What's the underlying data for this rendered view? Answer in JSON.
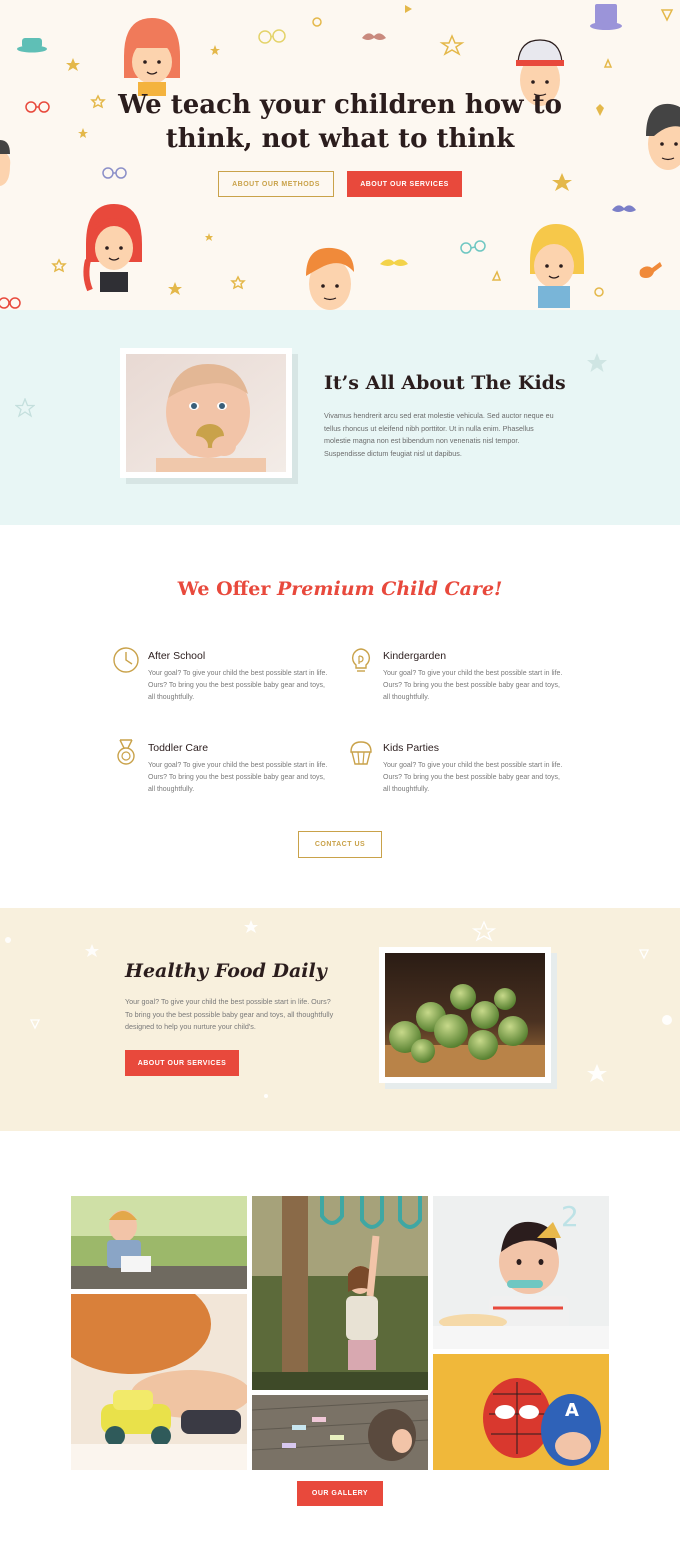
{
  "hero": {
    "title_pre": "We teach your children ",
    "title_bold1": "how to",
    "title_bold2": "think",
    "title_post": ", not what to think",
    "btn_methods": "About our methods",
    "btn_services": "About our services"
  },
  "kids": {
    "title_light": "It’s All About ",
    "title_bold": "The Kids",
    "text": "Vivamus hendrerit arcu sed erat molestie vehicula. Sed auctor neque eu tellus rhoncus ut eleifend nibh porttitor. Ut in nulla enim. Phasellus molestie magna non est bibendum non venenatis nisl tempor. Suspendisse dictum feugiat nisl ut dapibus."
  },
  "offer": {
    "title_bold": "We Offer",
    "title_italic": " Premium Child Care!",
    "services": [
      {
        "title": "After School",
        "icon": "clock-icon",
        "text": "Your goal? To give your child the best possible start in life. Ours? To bring you the best possible baby gear and toys, all thoughtfully."
      },
      {
        "title": "Kindergarden",
        "icon": "lightbulb-icon",
        "text": "Your goal? To give your child the best possible start in life. Ours? To bring you the best possible baby gear and toys, all thoughtfully."
      },
      {
        "title": "Toddler Care",
        "icon": "medal-icon",
        "text": "Your goal? To give your child the best possible start in life. Ours? To bring you the best possible baby gear and toys, all thoughtfully."
      },
      {
        "title": "Kids Parties",
        "icon": "cupcake-icon",
        "text": "Your goal? To give your child the best possible start in life. Ours? To bring you the best possible baby gear and toys, all thoughtfully."
      }
    ],
    "contact_btn": "Contact us"
  },
  "food": {
    "title_bold": "Healthy Food",
    "title_italic": " Daily",
    "text": "Your goal? To give your child the best possible start in life. Ours? To bring you the best possible baby gear and toys, all thoughtfully designed to help you nurture your child's.",
    "btn": "About our services"
  },
  "gallery": {
    "btn": "Our gallery"
  },
  "colors": {
    "accent_red": "#e8493c",
    "accent_gold": "#c9a24a",
    "hero_bg": "#fdf8f1",
    "kids_bg": "#e8f6f5",
    "food_bg": "#f8f0dd"
  }
}
